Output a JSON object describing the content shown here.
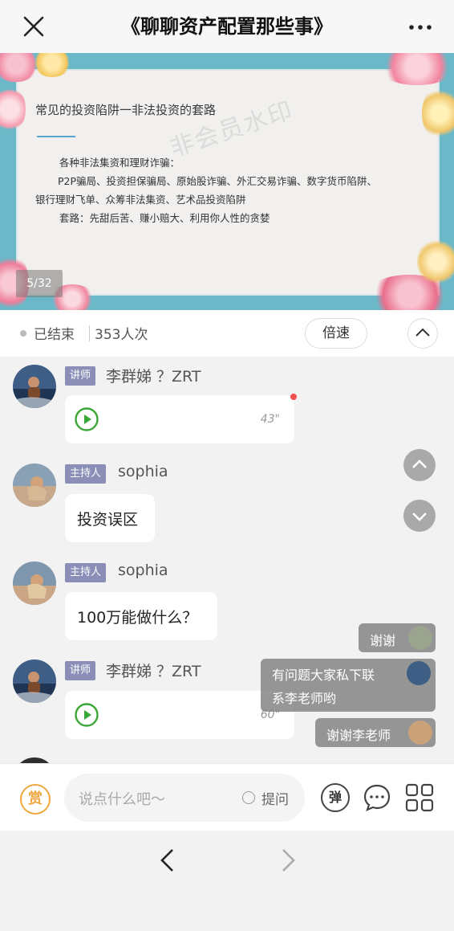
{
  "header": {
    "title": "《聊聊资产配置那些事》"
  },
  "slide": {
    "heading": "常见的投资陷阱一非法投资的套路",
    "lines": [
      "各种非法集资和理财诈骗：",
      "P2P骗局、投资担保骗局、原始股诈骗、外汇交易诈骗、数字货币陷阱、",
      "银行理财飞单、众筹非法集资、艺术品投资陷阱",
      "套路：先甜后苦、赚小赔大、利用你人性的贪婪"
    ],
    "watermark": "非会员水印",
    "page_indicator": "5/32"
  },
  "status": {
    "state": "已结束",
    "views": "353人次",
    "speed_label": "倍速"
  },
  "messages": [
    {
      "role": "讲师",
      "name": "李群娣 ？ZRT",
      "type": "voice",
      "duration": "43\""
    },
    {
      "role": "主持人",
      "name": "sophia",
      "type": "text",
      "text": "投资误区"
    },
    {
      "role": "主持人",
      "name": "sophia",
      "type": "text",
      "text": "100万能做什么？"
    },
    {
      "role": "讲师",
      "name": "李群娣 ？ZRT",
      "type": "voice",
      "duration": "60\""
    }
  ],
  "danmaku": [
    "谢谢",
    "有问题大家私下联系李老师哟",
    "谢谢李老师"
  ],
  "danmaku_lines": {
    "line1": "有问题大家私下联",
    "line2": "系李老师哟"
  },
  "input": {
    "reward_label": "赏",
    "placeholder": "说点什么吧～",
    "ask_label": "提问",
    "danmu_label": "弹"
  },
  "colors": {
    "accent_orange": "#f0a740",
    "role_badge": "#8b8fb7",
    "play_green": "#3aa636",
    "slide_frame": "#6bb8c9"
  }
}
